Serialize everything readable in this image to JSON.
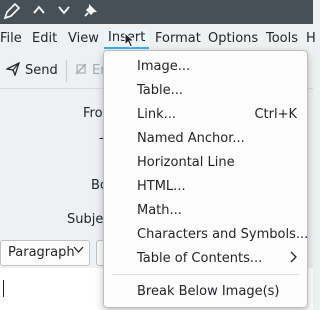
{
  "menubar": {
    "items": [
      "File",
      "Edit",
      "View",
      "Insert",
      "Format",
      "Options",
      "Tools",
      "H"
    ],
    "active_index": 3
  },
  "toolbar": {
    "send_label": "Send",
    "encrypt_label": "En"
  },
  "form": {
    "from_label": "Fro",
    "to_label": "-",
    "bcc_label": "Bc",
    "subject_label": "Subje"
  },
  "format_bar": {
    "paragraph_label": "Paragraph"
  },
  "insert_menu": {
    "items": [
      {
        "label": "Image...",
        "shortcut": ""
      },
      {
        "label": "Table...",
        "shortcut": ""
      },
      {
        "label": "Link...",
        "shortcut": "Ctrl+K"
      },
      {
        "label": "Named Anchor...",
        "shortcut": ""
      },
      {
        "label": "Horizontal Line",
        "shortcut": ""
      },
      {
        "label": "HTML...",
        "shortcut": ""
      },
      {
        "label": "Math...",
        "shortcut": ""
      },
      {
        "label": "Characters and Symbols...",
        "shortcut": ""
      },
      {
        "label": "Table of Contents...",
        "shortcut": "",
        "submenu": true
      },
      {
        "label": "Break Below Image(s)",
        "shortcut": ""
      }
    ]
  },
  "colors": {
    "titlebar": "#475057",
    "accent": "#3daee9",
    "window_bg": "#eff0f1"
  }
}
